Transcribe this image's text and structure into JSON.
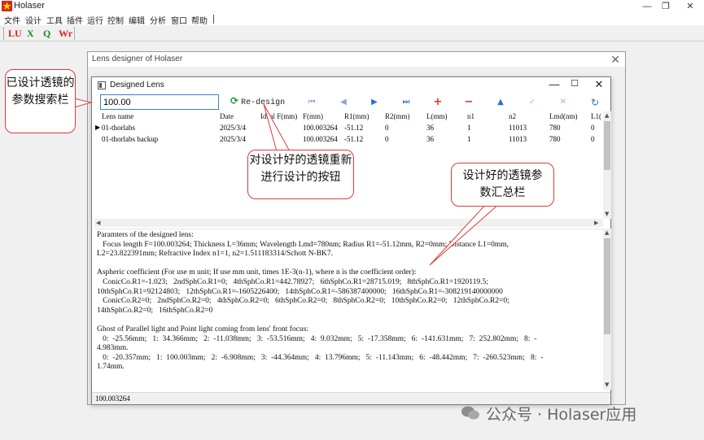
{
  "app": {
    "title": "Holaser",
    "menus": [
      "文件",
      "设计",
      "工具",
      "插件",
      "运行",
      "控制",
      "编辑",
      "分析",
      "窗口",
      "帮助"
    ],
    "toolbar": [
      "LU",
      "X",
      "Q",
      "Wr"
    ]
  },
  "lens_designer": {
    "title": "Lens designer of Holaser"
  },
  "dialog": {
    "title": "Designed Lens",
    "search_value": "100.00",
    "redesign_label": "Re-design",
    "nav_icons": [
      "first-icon",
      "prev-icon",
      "next-icon",
      "last-icon",
      "add-icon",
      "remove-icon",
      "up-icon",
      "confirm-icon",
      "cancel-icon",
      "refresh-icon"
    ],
    "columns": [
      "Lens name",
      "Date",
      "Ideal F(mm)",
      "F(mm)",
      "R1(mm)",
      "R2(mm)",
      "L(mm)",
      "n1",
      "n2",
      "Lmd(nm)",
      "L1("
    ],
    "rows": [
      [
        "01-thorlabs",
        "2025/3/4",
        "",
        "100.003264",
        "-51.12",
        "0",
        "36",
        "1",
        "11013",
        "780",
        "0"
      ],
      [
        "01-thorlabs backup",
        "2025/3/4",
        "",
        "100.003264",
        "-51.12",
        "0",
        "36",
        "1",
        "11013",
        "780",
        "0"
      ]
    ],
    "summary_lines": [
      "Paramters of the designed lens:",
      "   Focus length F=100.003264; Thickness L=36mm; Wavelength Lmd=780nm; Radius R1=-51.12mm, R2=0mm; Distance L1=0mm,",
      "L2=23.822391mm; Refractive Index n1=1, n2=1.511183314/Schott N-BK7.",
      "",
      "Aspheric coefficient (For use m unit; If use mm unit, times 1E-3(n-1), where n is the coefficient order):",
      "   ConicCo.R1=-1.023;   2ndSphCo.R1=0;   4thSphCo.R1=442.78927;   6thSphCo.R1=28715.019;   8thSphCo.R1=1920119.5;",
      "10thSphCo.R1=92124803;   12thSphCo.R1=-1605226400;   14thSphCo.R1=-586387400000;   16thSphCo.R1=-308219140000000",
      "   ConicCo.R2=0;   2ndSphCo.R2=0;   4thSphCo.R2=0;   6thSphCo.R2=0;   8thSphCo.R2=0;   10thSphCo.R2=0;   12thSphCo.R2=0;",
      "14thSphCo.R2=0;   16thSphCo.R2=0",
      "",
      "Ghost of Parallel light and Point light coming from lens' front focus:",
      "   0:  -25.56mm;   1:  34.366mm;   2:  -11.038mm;   3:  -53.516mm;   4:  9.032mm;   5:  -17.358mm;   6:  -141.631mm;   7:  252.802mm;   8:  -",
      "4.983mm.",
      "   0:  -20.357mm;   1:  100.003mm;   2:  -6.908mm;   3:  -44.364mm;   4:  13.796mm;   5:  -11.143mm;   6:  -48.442mm;   7:  -260.523mm;   8:  -",
      "1.74mm."
    ],
    "status_value": "100.003264"
  },
  "callouts": {
    "search": "已设计透镜的参数搜索栏",
    "redesign": "对设计好的透镜重新进行设计的按钮",
    "summary": "设计好的透镜参数汇总栏"
  },
  "watermark": "公众号 · Holaser应用",
  "colors": {
    "callout_border": "#e03a3a",
    "arrow": "#e03a3a",
    "search_border": "#3a7fd4",
    "redesign_icon": "#1e8f3a",
    "nav_blue": "#2f6fd1",
    "nav_red": "#d93025"
  }
}
